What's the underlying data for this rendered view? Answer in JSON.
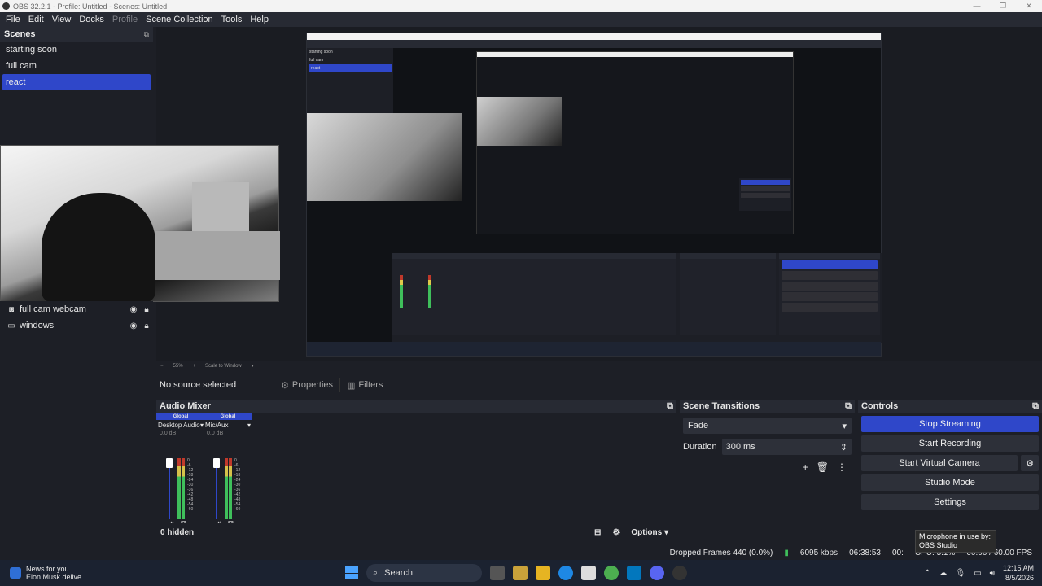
{
  "window": {
    "title": "OBS 32.2.1 - Profile: Untitled - Scenes: Untitled"
  },
  "menu": [
    "File",
    "Edit",
    "View",
    "Docks",
    "Profile",
    "Scene Collection",
    "Tools",
    "Help"
  ],
  "scenes": {
    "title": "Scenes",
    "items": [
      "starting soon",
      "full cam",
      "react"
    ],
    "active": "react"
  },
  "sources": {
    "items": [
      {
        "name": "full cam webcam",
        "icon": "camera-icon"
      },
      {
        "name": "windows",
        "icon": "window-icon"
      }
    ]
  },
  "zoom": {
    "level": "55%",
    "mode": "Scale to Window"
  },
  "source_bar": {
    "empty_text": "No source selected",
    "properties": "Properties",
    "filters": "Filters"
  },
  "audio_mixer": {
    "title": "Audio Mixer",
    "channels": [
      {
        "badge": "Global",
        "name": "Desktop Audio",
        "level": "0.0 dB"
      },
      {
        "badge": "Global",
        "name": "Mic/Aux",
        "level": "0.0 dB"
      }
    ],
    "scale": [
      "0",
      "-6",
      "-12",
      "-18",
      "-24",
      "-30",
      "-36",
      "-42",
      "-48",
      "-54",
      "-60"
    ],
    "hidden": "0 hidden",
    "options": "Options"
  },
  "transitions": {
    "title": "Scene Transitions",
    "type": "Fade",
    "duration_label": "Duration",
    "duration": "300 ms"
  },
  "controls": {
    "title": "Controls",
    "stop_streaming": "Stop Streaming",
    "start_recording": "Start Recording",
    "start_virtual_camera": "Start Virtual Camera",
    "studio_mode": "Studio Mode",
    "settings": "Settings"
  },
  "status": {
    "dropped": "Dropped Frames 440 (0.0%)",
    "kbps": "6095 kbps",
    "stream_time": "06:38:53",
    "rec_time": "00:",
    "cpu": "CPU: 5.1%",
    "fps": "00.00 / 60.00 FPS"
  },
  "tooltip": {
    "line1": "Microphone in use by:",
    "line2": "OBS Studio"
  },
  "taskbar": {
    "news_title": "News for you",
    "news_sub": "Elon Musk delive...",
    "search": "Search",
    "time": "12:15 AM",
    "date": "8/5/2026"
  },
  "colors": {
    "accent": "#2f47c9",
    "panel": "#1d1f26",
    "header": "#272a33"
  }
}
